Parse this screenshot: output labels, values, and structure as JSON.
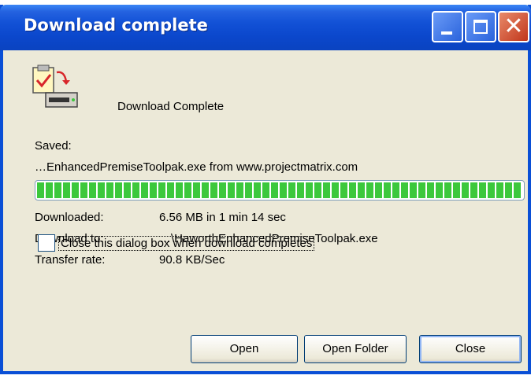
{
  "window": {
    "title": "Download complete"
  },
  "header": {
    "message": "Download Complete"
  },
  "saved": {
    "label": "Saved:",
    "file_info": "…EnhancedPremiseToolpak.exe from www.projectmatrix.com"
  },
  "progress": {
    "percent": 100,
    "color": "#3cc83c"
  },
  "details": {
    "downloaded_label": "Downloaded:",
    "downloaded_value": "6.56 MB in 1 min 14 sec",
    "download_to_label": "Download to:",
    "download_to_value": "…\\HaworthEnhancedPremiseToolpak.exe",
    "transfer_rate_label": "Transfer rate:",
    "transfer_rate_value": "90.8 KB/Sec"
  },
  "options": {
    "close_when_complete_label": "Close this dialog box when download completes",
    "close_when_complete_checked": false
  },
  "buttons": {
    "open": "Open",
    "open_folder": "Open Folder",
    "close": "Close"
  },
  "icons": {
    "minimize": "minimize-icon",
    "maximize": "maximize-icon",
    "close": "close-icon",
    "download_complete": "download-complete-icon"
  }
}
